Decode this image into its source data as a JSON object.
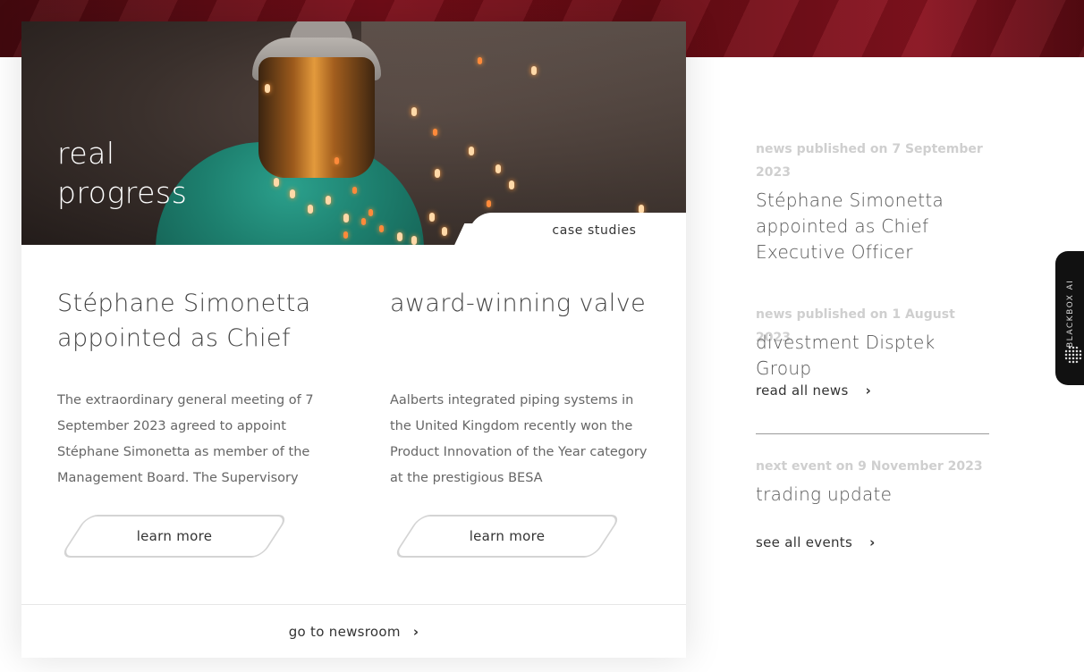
{
  "hero": {
    "title": "real\nprogress",
    "tag": "case studies"
  },
  "articles": [
    {
      "title": "Stéphane Simonetta appointed as Chief",
      "excerpt": "The extraordinary general meeting of 7 September 2023 agreed to appoint Stéphane Simonetta as member of the Management Board. The Supervisory",
      "button": "learn more"
    },
    {
      "title": "award-winning valve",
      "excerpt": "Aalberts integrated piping systems in the United Kingdom recently won the Product Innovation of the Year category at the prestigious BESA",
      "button": "learn more"
    }
  ],
  "newsroom_link": "go to newsroom",
  "side": {
    "news": [
      {
        "meta": "news published on 7 September 2023",
        "title": "Stéphane Simonetta appointed as Chief Executive Officer"
      },
      {
        "meta": "news published on 1 August 2023",
        "title": "divestment Disptek Group"
      }
    ],
    "read_all": "read all news",
    "event": {
      "meta": "next event on 9 November 2023",
      "title": "trading update"
    },
    "see_all": "see all events"
  },
  "assistant_tab": {
    "label": "BLACKBOX AI"
  },
  "icons": {
    "chevron": "chevron-right-icon",
    "assistant": "blackbox-dots-icon"
  },
  "colors": {
    "band": "#7d0f1a",
    "welder_suit": "#1d7f6e",
    "meta_grey": "#cfcfcf"
  }
}
